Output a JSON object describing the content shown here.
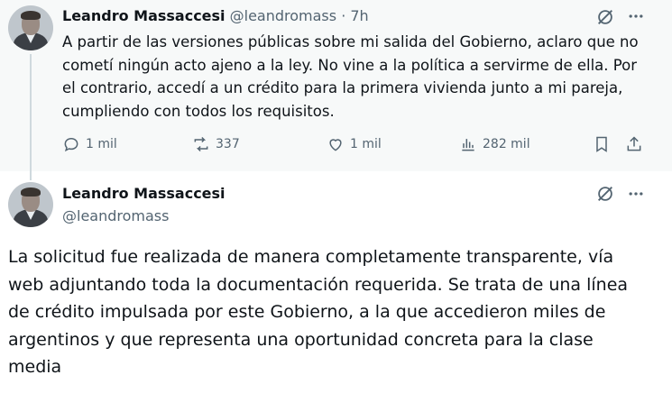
{
  "parent_tweet": {
    "author_name": "Leandro Massaccesi",
    "author_handle": "@leandromass",
    "separator": "·",
    "time": "7h",
    "text": "A partir de las versiones públicas sobre mi salida del Gobierno, aclaro que no cometí ningún acto ajeno a la ley. No vine a la política a servirme de ella. Por el contrario, accedí a un crédito para la primera vivienda junto a mi pareja, cumpliendo con todos los requisitos.",
    "replies": "1 mil",
    "reposts": "337",
    "likes": "1 mil",
    "views": "282 mil",
    "icons": [
      "grok-icon",
      "more-icon",
      "reply-icon",
      "repost-icon",
      "like-icon",
      "views-icon",
      "bookmark-icon",
      "share-icon"
    ]
  },
  "main_tweet": {
    "author_name": "Leandro Massaccesi",
    "author_handle": "@leandromass",
    "text": "La solicitud fue realizada de manera completamente transparente, vía web adjuntando toda la documentación requerida. Se trata de una línea de crédito impulsada por este Gobierno, a la que accedieron miles de argentinos y que representa una oportunidad concreta para la clase media",
    "icons": [
      "grok-icon",
      "more-icon"
    ]
  }
}
